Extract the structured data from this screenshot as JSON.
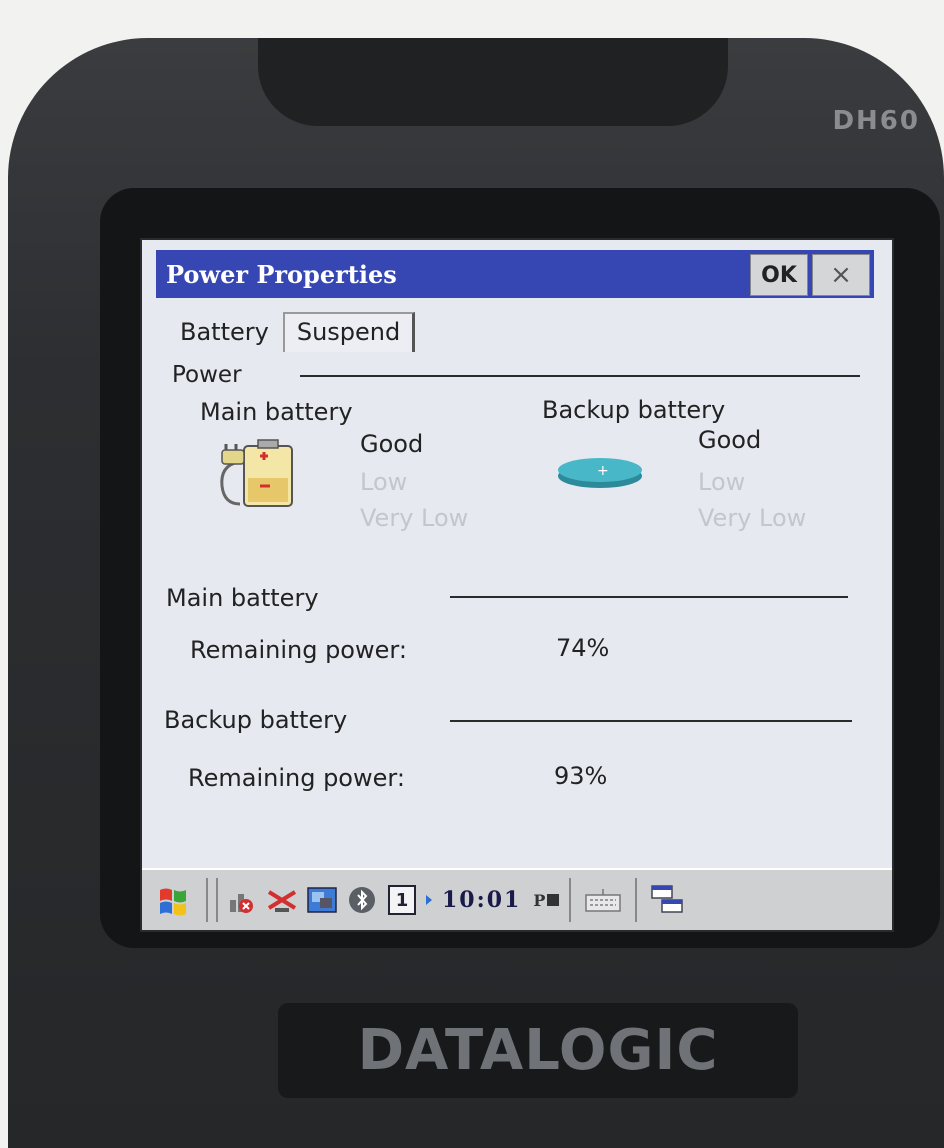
{
  "device": {
    "model": "DH60",
    "brand": "DATALOGIC"
  },
  "window": {
    "title": "Power Properties",
    "ok_label": "OK",
    "close_label": "×"
  },
  "tabs": [
    {
      "label": "Battery"
    },
    {
      "label": "Suspend"
    }
  ],
  "power_section": {
    "label": "Power",
    "main": {
      "heading": "Main battery",
      "states": [
        "Good",
        "Low",
        "Very Low"
      ],
      "active_state": "Good"
    },
    "backup": {
      "heading": "Backup battery",
      "states": [
        "Good",
        "Low",
        "Very Low"
      ],
      "active_state": "Good"
    }
  },
  "main_battery": {
    "label": "Main battery",
    "remaining_label": "Remaining power:",
    "remaining_value": "74%"
  },
  "backup_battery": {
    "label": "Backup battery",
    "remaining_label": "Remaining power:",
    "remaining_value": "93%"
  },
  "taskbar": {
    "clock": "10:01",
    "ampm": "P",
    "input_panel_number": "1"
  },
  "colors": {
    "titlebar": "#3647b3",
    "screen_bg": "#e7e9f1",
    "dim_text": "#c3c6cf"
  }
}
